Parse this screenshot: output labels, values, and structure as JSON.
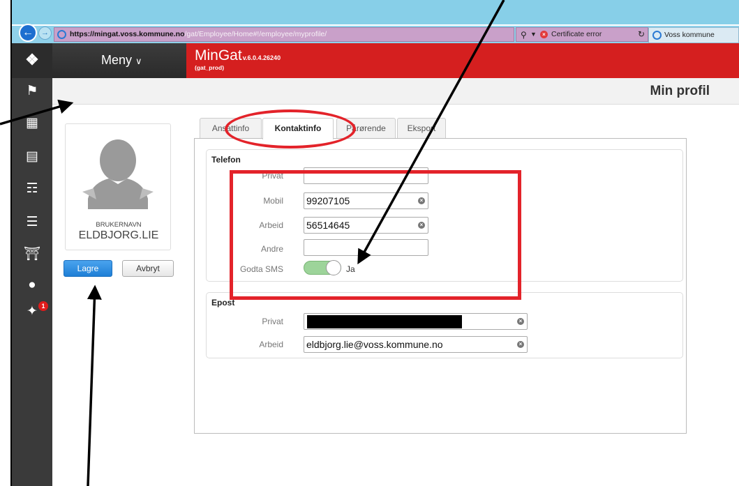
{
  "browser": {
    "url_host": "https://mingat.voss.kommune.no",
    "url_path": "/gat/Employee/Home#!/employee/myprofile/",
    "cert_error": "Certificate error",
    "tab_label": "Voss kommune"
  },
  "header": {
    "menu_label": "Meny",
    "app_name": "MinGat",
    "version": "v.6.0.4.26240",
    "environment": "(gat_prod)"
  },
  "page": {
    "title": "Min profil"
  },
  "profile": {
    "username_label": "BRUKERNAVN",
    "username": "ELDBJORG.LIE",
    "save_label": "Lagre",
    "cancel_label": "Avbryt"
  },
  "nav": {
    "badge_count": "1"
  },
  "tabs": [
    {
      "label": "Ansattinfo"
    },
    {
      "label": "Kontaktinfo"
    },
    {
      "label": "Pårørende"
    },
    {
      "label": "Eksport"
    }
  ],
  "telefon": {
    "title": "Telefon",
    "privat_label": "Privat",
    "privat_value": "",
    "mobil_label": "Mobil",
    "mobil_value": "99207105",
    "arbeid_label": "Arbeid",
    "arbeid_value": "56514645",
    "andre_label": "Andre",
    "andre_value": "",
    "sms_label": "Godta SMS",
    "sms_value": "Ja"
  },
  "epost": {
    "title": "Epost",
    "privat_label": "Privat",
    "arbeid_label": "Arbeid",
    "arbeid_value": "eldbjorg.lie@voss.kommune.no"
  },
  "colors": {
    "header_red": "#d51f1f",
    "annotation_red": "#e3232a",
    "primary_blue": "#1e7fd6",
    "toggle_green": "#9dd49a"
  }
}
